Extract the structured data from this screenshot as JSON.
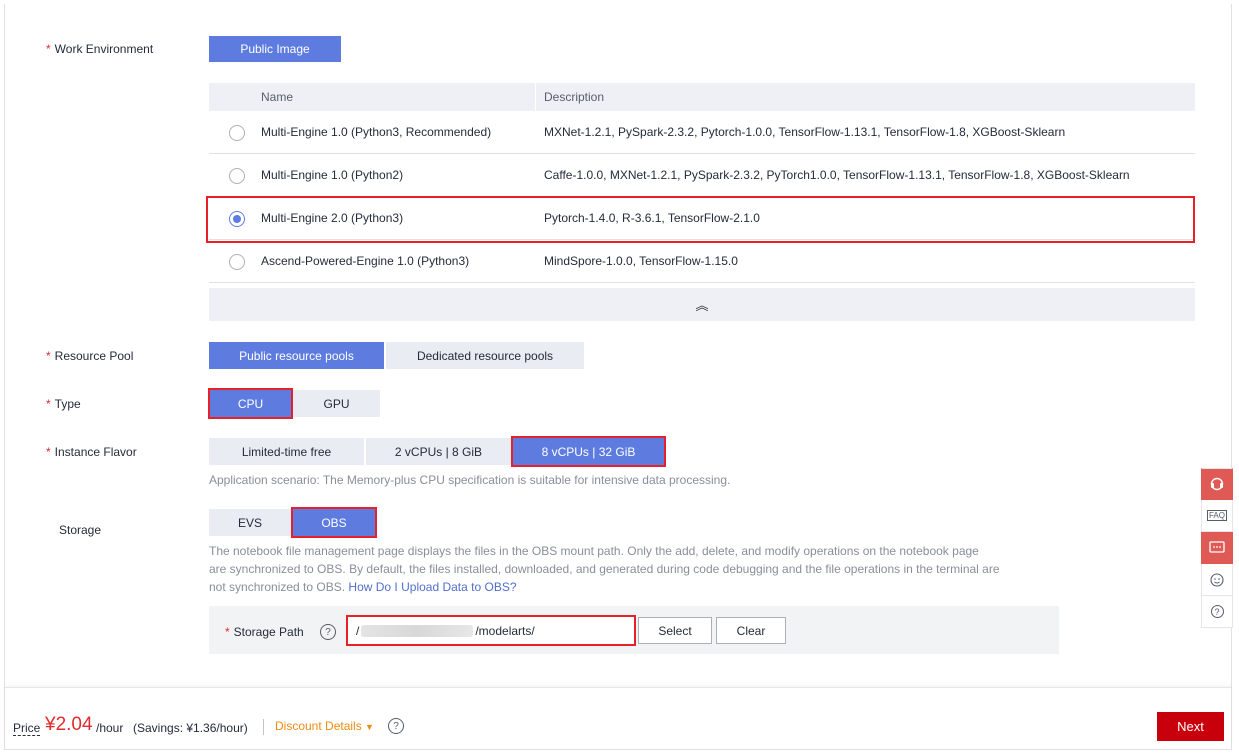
{
  "work_environment": {
    "label": "Work Environment",
    "button": "Public Image",
    "table": {
      "headers": [
        "Name",
        "Description"
      ],
      "rows": [
        {
          "name": "Multi-Engine 1.0 (Python3, Recommended)",
          "desc": "MXNet-1.2.1, PySpark-2.3.2, Pytorch-1.0.0, TensorFlow-1.13.1, TensorFlow-1.8, XGBoost-Sklearn",
          "selected": false
        },
        {
          "name": "Multi-Engine 1.0 (Python2)",
          "desc": "Caffe-1.0.0, MXNet-1.2.1, PySpark-2.3.2, PyTorch1.0.0, TensorFlow-1.13.1, TensorFlow-1.8, XGBoost-Sklearn",
          "selected": false
        },
        {
          "name": "Multi-Engine 2.0 (Python3)",
          "desc": "Pytorch-1.4.0, R-3.6.1, TensorFlow-2.1.0",
          "selected": true
        },
        {
          "name": "Ascend-Powered-Engine 1.0 (Python3)",
          "desc": "MindSpore-1.0.0,  TensorFlow-1.15.0",
          "selected": false
        }
      ],
      "collapse_icon": "double-chevron-up-icon",
      "collapse_glyph": "︽"
    }
  },
  "resource_pool": {
    "label": "Resource Pool",
    "options": [
      "Public resource pools",
      "Dedicated resource pools"
    ],
    "selected": "Public resource pools"
  },
  "type": {
    "label": "Type",
    "options": [
      "CPU",
      "GPU"
    ],
    "selected": "CPU"
  },
  "instance_flavor": {
    "label": "Instance Flavor",
    "options": [
      "Limited-time free",
      "2 vCPUs | 8 GiB",
      "8 vCPUs | 32 GiB"
    ],
    "selected": "8 vCPUs | 32 GiB",
    "note": "Application scenario: The Memory-plus CPU specification is suitable for intensive data processing."
  },
  "storage": {
    "label": "Storage",
    "options": [
      "EVS",
      "OBS"
    ],
    "selected": "OBS",
    "note_line1": "The notebook file management page displays the files in the OBS mount path. Only the add, delete, and modify operations on the notebook page",
    "note_line2": "are synchronized to OBS. By default, the files installed, downloaded, and generated during code debugging and the file operations in the terminal are",
    "note_line3": "not synchronized to OBS.",
    "note_link": "How Do I Upload Data to OBS?",
    "path_label": "Storage Path",
    "path_prefix": "/",
    "path_suffix": "/modelarts/",
    "select_label": "Select",
    "clear_label": "Clear"
  },
  "footer": {
    "price_label": "Price",
    "price": "¥2.04",
    "price_unit": "/hour",
    "savings": "(Savings: ¥1.36/hour)",
    "discount": "Discount Details",
    "next": "Next"
  },
  "side_tools": {
    "faq": "FAQ",
    "help": "?"
  },
  "colors": {
    "primary": "#5e7ce0",
    "highlight": "#e8202a",
    "next_button": "#c7000b",
    "price": "#e02c2c",
    "discount": "#ed8b12"
  }
}
